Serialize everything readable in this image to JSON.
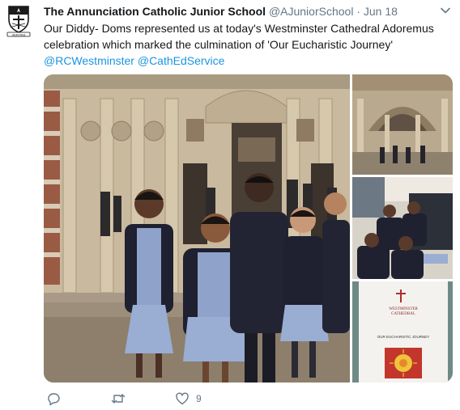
{
  "tweet": {
    "author_name": "The Annunciation Catholic Junior School",
    "handle": "@AJuniorSchool",
    "separator": "·",
    "date": "Jun 18",
    "text_lines": [
      "Our Diddy- Doms represented us at today's Westminster Cathedral Adoremus",
      "celebration which marked the culmination of 'Our Eucharistic Journey'"
    ],
    "mentions": [
      "@RCWestminster",
      "@CathEdService"
    ],
    "likes": "9",
    "avatar_caption": "VERITAS"
  },
  "program_card": {
    "heading_1": "WESTMINSTER",
    "heading_2": "CATHEDRAL",
    "subtitle": "OUR EUCHARISTIC JOURNEY"
  },
  "icons": {
    "avatar": "school-crest-icon",
    "caret": "chevron-down-icon",
    "reply": "reply-icon",
    "retweet": "retweet-icon",
    "like": "heart-icon"
  },
  "colors": {
    "text": "#14171a",
    "secondary": "#657786",
    "link": "#1b95e0"
  }
}
